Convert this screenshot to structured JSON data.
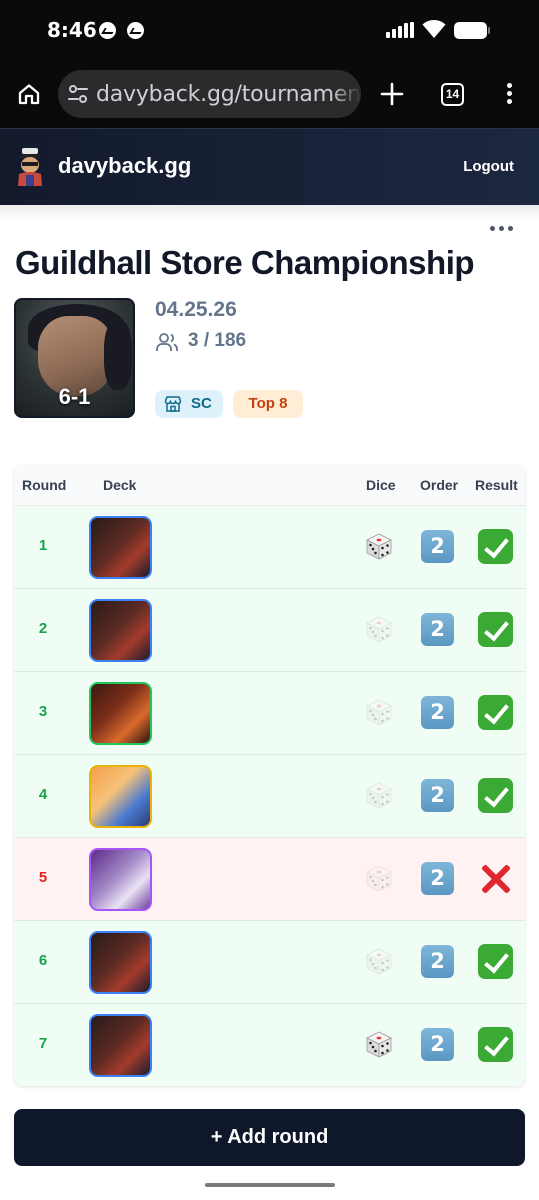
{
  "status_bar": {
    "time": "8:46",
    "icons": [
      "messenger-icon",
      "messenger-icon",
      "signal-icon",
      "wifi-icon",
      "battery-icon"
    ]
  },
  "browser": {
    "url": "davyback.gg/tournaments",
    "tab_count": "14",
    "icons": [
      "home-icon",
      "site-settings-icon",
      "new-tab-icon",
      "tabs-icon",
      "more-vert-icon"
    ]
  },
  "site_header": {
    "site_name": "davyback.gg",
    "logout_label": "Logout"
  },
  "tournament": {
    "title": "Guildhall Store Championship",
    "date": "04.25.26",
    "players": "3 / 186",
    "record": "6-1",
    "badges": {
      "sc": "SC",
      "top8": "Top 8"
    }
  },
  "table": {
    "headers": {
      "round": "Round",
      "deck": "Deck",
      "dice": "Dice",
      "order": "Order",
      "result": "Result"
    },
    "rows": [
      {
        "round": "1",
        "dice": "won",
        "order": "2",
        "result": "win",
        "deck_color": "blue-red"
      },
      {
        "round": "2",
        "dice": "lost",
        "order": "2",
        "result": "win",
        "deck_color": "blue-red"
      },
      {
        "round": "3",
        "dice": "lost",
        "order": "2",
        "result": "win",
        "deck_color": "green-red"
      },
      {
        "round": "4",
        "dice": "lost",
        "order": "2",
        "result": "win",
        "deck_color": "yellow-blue"
      },
      {
        "round": "5",
        "dice": "lost",
        "order": "2",
        "result": "loss",
        "deck_color": "purple"
      },
      {
        "round": "6",
        "dice": "lost",
        "order": "2",
        "result": "win",
        "deck_color": "blue-red"
      },
      {
        "round": "7",
        "dice": "won",
        "order": "2",
        "result": "win",
        "deck_color": "blue-red"
      }
    ]
  },
  "actions": {
    "add_round_label": "+ Add round"
  },
  "colors": {
    "header_bg": "#131a2c",
    "win_row": "#f0fdf4",
    "loss_row": "#fef2f2",
    "win_text": "#16a34a",
    "loss_text": "#dc2626",
    "button_bg": "#0f172a",
    "sc_badge": "#ddf1fb",
    "top8_badge": "#ffedd5"
  }
}
